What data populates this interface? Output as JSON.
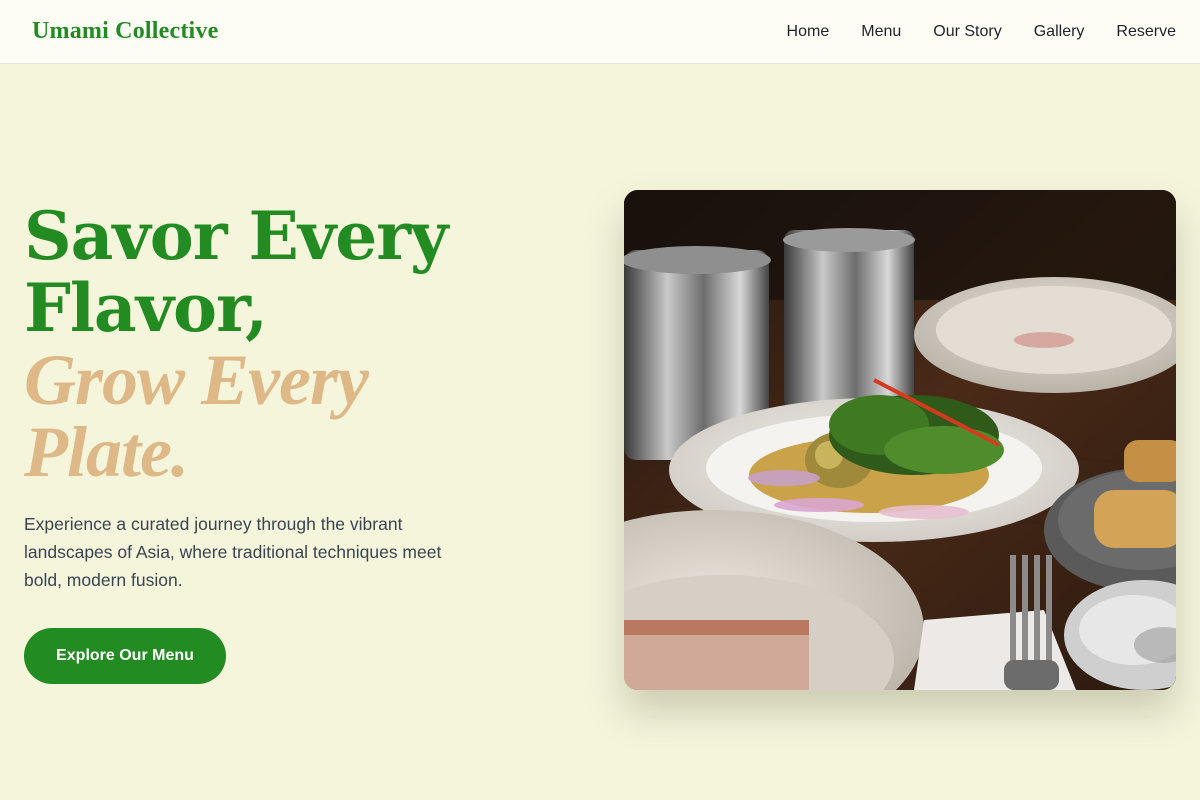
{
  "brand": {
    "name": "Umami Collective",
    "accent": "#228b22",
    "tan": "#deb887",
    "background": "#f5f5dc"
  },
  "nav": {
    "items": [
      {
        "label": "Home"
      },
      {
        "label": "Menu"
      },
      {
        "label": "Our Story"
      },
      {
        "label": "Gallery"
      },
      {
        "label": "Reserve"
      }
    ]
  },
  "hero": {
    "headline_line1": "Savor Every",
    "headline_line2": "Flavor,",
    "headline_line3": "Grow Every",
    "headline_line4": "Plate.",
    "description": "Experience a curated journey through the vibrant landscapes of Asia, where traditional techniques meet bold, modern fusion.",
    "cta_label": "Explore Our Menu",
    "image_alt": "Plated Asian herb salad with spring rolls on a wooden table"
  }
}
